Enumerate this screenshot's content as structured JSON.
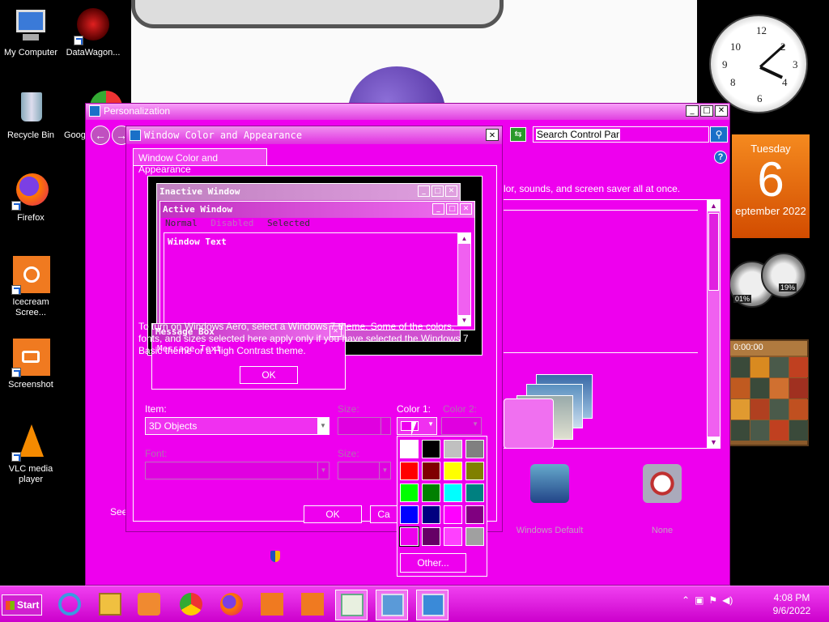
{
  "desktop": {
    "icons": [
      {
        "label": "My Computer",
        "icon": "computer-icon"
      },
      {
        "label": "DataWagon...",
        "icon": "datawagon-icon"
      },
      {
        "label": "Recycle Bin",
        "icon": "recycle-bin-icon"
      },
      {
        "label": "Goog",
        "icon": "chrome-icon"
      },
      {
        "label": "Firefox",
        "icon": "firefox-icon"
      },
      {
        "label": "Icecream Scree...",
        "icon": "icecream-icon"
      },
      {
        "label": "Screenshot",
        "icon": "screenshot-icon"
      },
      {
        "label": "VLC media player",
        "icon": "vlc-icon"
      }
    ]
  },
  "gadgets": {
    "calendar": {
      "weekday": "Tuesday",
      "day": "6",
      "month_year": "eptember 2022"
    },
    "meters": {
      "cpu": "01%",
      "memory": "19%"
    },
    "puzzle_timer": "0:00:00"
  },
  "personalization": {
    "title": "Personalization",
    "search_placeholder": "Search Control Panel",
    "description": "lor, sounds, and screen saver all at once.",
    "see_also": "See",
    "sounds_label": "Windows Default",
    "screensaver_label": "None"
  },
  "wca_dialog": {
    "title": "Window Color and Appearance",
    "tab": "Window Color and Appearance",
    "preview": {
      "inactive_title": "Inactive Window",
      "active_title": "Active Window",
      "menu": [
        "Normal",
        "Disabled",
        "Selected"
      ],
      "window_text": "Window Text",
      "msgbox_title": "Message Box",
      "msgbox_text": "Message Text",
      "msgbox_ok": "OK"
    },
    "info": "To turn on Windows Aero, select a Windows 7 theme.  Some of the colors, fonts, and sizes selected here apply only if you have selected the Windows 7 Basic theme or a High Contrast theme.",
    "item_label": "Item:",
    "item_value": "3D Objects",
    "size_label": "Size:",
    "color1_label": "Color 1:",
    "color2_label": "Color 2:",
    "font_label": "Font:",
    "size2_label": "Size:",
    "ok": "OK",
    "cancel": "Ca"
  },
  "palette": {
    "colors": [
      "#ffffff",
      "#000000",
      "#c0c0c0",
      "#808080",
      "#ff0000",
      "#800000",
      "#ffff00",
      "#808000",
      "#00ff00",
      "#008000",
      "#00ffff",
      "#008080",
      "#0000ff",
      "#000080",
      "#ff00ff",
      "#800080",
      "#ee00ee",
      "#660066",
      "#ff40ff",
      "#a0a0a0"
    ],
    "selected_index": 16,
    "other": "Other..."
  },
  "taskbar": {
    "start": "Start",
    "apps": [
      "ie-icon",
      "explorer-icon",
      "media-player-icon",
      "chrome-icon",
      "firefox-icon",
      "icecream-icon",
      "screenshot-icon",
      "notepad-icon",
      "control-panel-icon",
      "display-icon"
    ],
    "time": "4:08 PM",
    "date": "9/6/2022"
  }
}
